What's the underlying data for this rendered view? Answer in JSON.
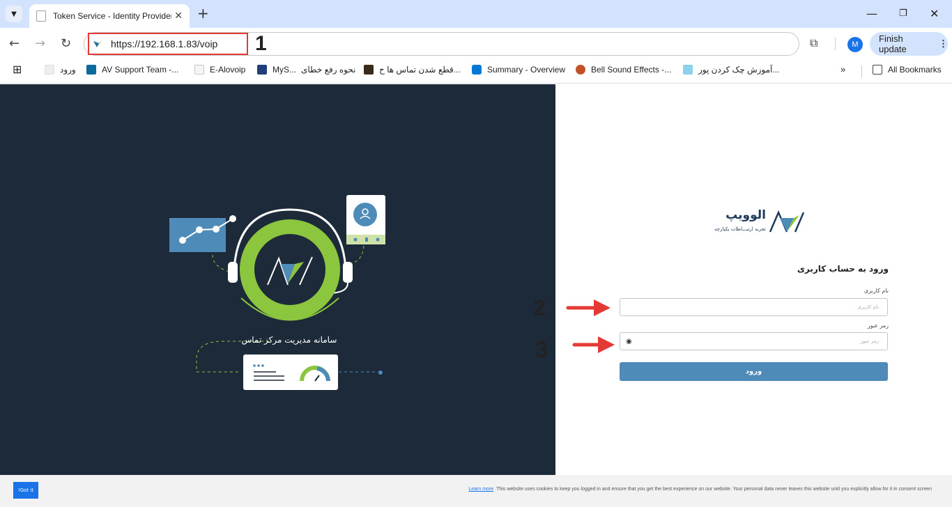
{
  "browser": {
    "tab_title": "Token Service - Identity Provider",
    "url": "https://192.168.1.83/voip",
    "finish_update": "Finish update",
    "avatar_letter": "M",
    "bookmarks": [
      "ورود",
      "AV Support Team -...",
      "E-Alovoip",
      "MyS...",
      "نحوه رفع خطای",
      "قطع شدن تماس ها ح...",
      "Summary - Overview",
      "Bell Sound Effects -...",
      "آموزش چک کردن پور...",
      "All Bookmarks"
    ]
  },
  "annotations": [
    "1",
    "2",
    "3"
  ],
  "illustration": {
    "caption": "سامانه مدیریت مرکز تماس"
  },
  "login": {
    "brand_name": "الوویپ",
    "brand_tagline": "تجربه ارتبـــاطات یکپارچه",
    "title": "ورود به حساب کاربری",
    "username_label": "نام کاربری",
    "username_placeholder": "نام کاربری",
    "password_label": "رمز عبور",
    "password_placeholder": "رمز عبور",
    "submit": "ورود"
  },
  "cookie": {
    "button": "!Got it",
    "learn_more": "Learn more",
    "text": ".This website uses cookies to keep you logged in and ensure that you get the best experience on our website. Your personal data never leaves this website until you explicitly allow for it in consent screen"
  },
  "colors": {
    "brand_green": "#8cc63f",
    "brand_blue": "#4f8bb8",
    "dark_bg": "#1c2a3a",
    "annotation_red": "#e53935"
  }
}
